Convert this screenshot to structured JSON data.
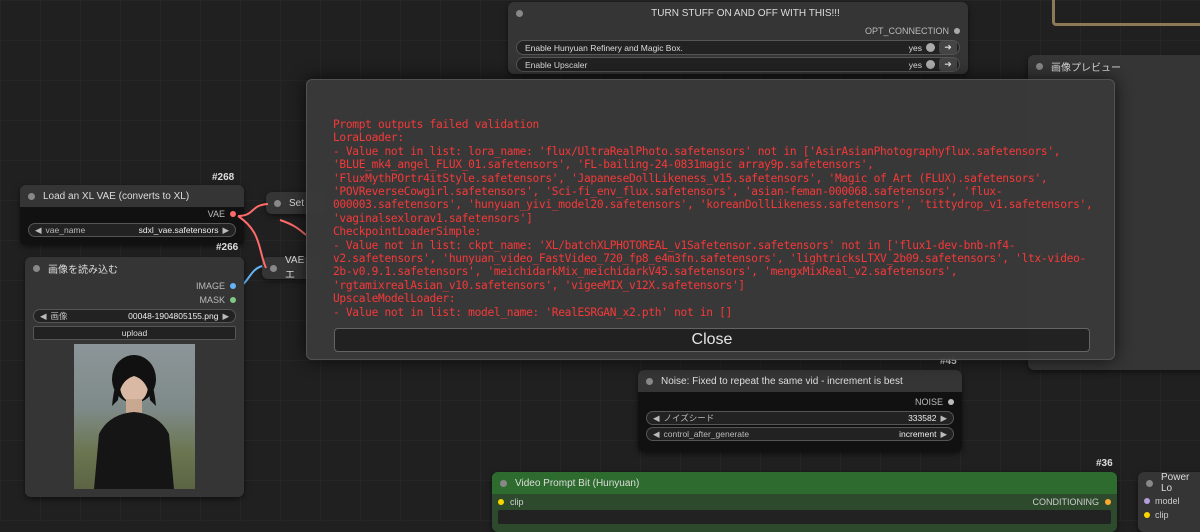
{
  "toggle_node": {
    "title": "TURN STUFF ON AND OFF WITH THIS!!!",
    "output": "OPT_CONNECTION",
    "toggles": [
      {
        "label": "Enable Hunyuan Refinery and Magic Box.",
        "value": "yes"
      },
      {
        "label": "Enable Upscaler",
        "value": "yes"
      }
    ]
  },
  "preview_node": {
    "title": "画像プレビュー"
  },
  "vae_node": {
    "badge": "#268",
    "title": "Load an XL VAE (converts to XL)",
    "output": "VAE",
    "widget_label": "vae_name",
    "widget_value": "sdxl_vae.safetensors"
  },
  "set_node": {
    "title": "Set"
  },
  "vae2_node": {
    "badge": "#266",
    "title": "VAEエ"
  },
  "load_image_node": {
    "title": "画像を読み込む",
    "outputs": [
      "IMAGE",
      "MASK"
    ],
    "widget_label": "画像",
    "widget_value": "00048-1904805155.png",
    "upload_label": "upload"
  },
  "noise_node": {
    "badge": "#45",
    "title": "Noise: Fixed to repeat the same vid - increment is best",
    "output": "NOISE",
    "seed_label": "ノイズシード",
    "seed_value": "333582",
    "control_label": "control_after_generate",
    "control_value": "increment"
  },
  "video_prompt_node": {
    "badge": "#36",
    "title": "Video Prompt Bit (Hunyuan)",
    "input": "clip",
    "output": "CONDITIONING"
  },
  "power_node": {
    "title": "Power Lo",
    "inputs": [
      "model",
      "clip"
    ]
  },
  "dialog": {
    "message": "Prompt outputs failed validation\nLoraLoader:\n- Value not in list: lora_name: 'flux/UltraRealPhoto.safetensors' not in ['AsirAsianPhotographyflux.safetensors', 'BLUE_mk4_angel_FLUX_01.safetensors', 'FL-bailing-24-0831magic array9p.safetensors', 'FluxMythPOrtr4itStyle.safetensors', 'JapaneseDollLikeness_v15.safetensors', 'Magic of Art (FLUX).safetensors', 'POVReverseCowgirl.safetensors', 'Sci-fi_env_flux.safetensors', 'asian-feman-000068.safetensors', 'flux-000003.safetensors', 'hunyuan_yivi_model20.safetensors', 'koreanDollLikeness.safetensors', 'tittydrop_v1.safetensors', 'vaginalsexlorav1.safetensors']\nCheckpointLoaderSimple:\n- Value not in list: ckpt_name: 'XL/batchXLPHOTOREAL_v1Safetensor.safetensors' not in ['flux1-dev-bnb-nf4-v2.safetensors', 'hunyuan_video_FastVideo_720_fp8_e4m3fn.safetensors', 'lightricksLTXV_2b09.safetensors', 'ltx-video-2b-v0.9.1.safetensors', 'meichidarkMix_meichidarkV45.safetensors', 'mengxMixReal_v2.safetensors', 'rgtamixrealAsian_v10.safetensors', 'vigeeMIX_v12X.safetensors']\nUpscaleModelLoader:\n- Value not in list: model_name: 'RealESRGAN_x2.pth' not in []",
    "close_label": "Close"
  },
  "colors": {
    "error_text": "#ff3a3a",
    "vae_socket": "#ff6b6b",
    "image_socket": "#64b5f6",
    "mask_socket": "#81c784",
    "conditioning_socket": "#ffa931",
    "clip_socket": "#ffd500"
  }
}
